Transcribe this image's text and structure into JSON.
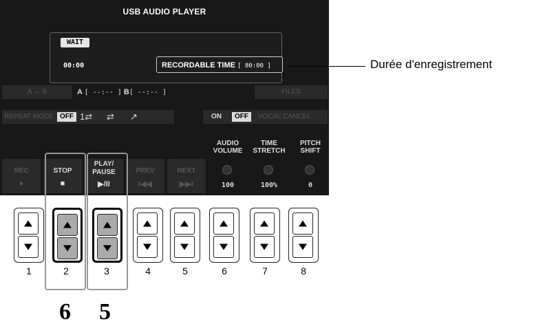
{
  "screen": {
    "title": "USB AUDIO PLAYER",
    "status": {
      "wait": "WAIT",
      "time": "00:00",
      "recordable_label": "RECORDABLE TIME",
      "recordable_value": "[ 80:00 ]"
    },
    "ab": {
      "button": "A ↔ B",
      "a_label": "A",
      "a_value": "[ --:-- ]",
      "b_label": "B",
      "b_value": "[ --:-- ]"
    },
    "files": "FILES",
    "repeat": {
      "label": "REPEAT MODE",
      "off": "OFF",
      "single_glyph": "1⇄",
      "all_glyph": "⇄",
      "random_glyph": "↗"
    },
    "vocal": {
      "on": "ON",
      "off": "OFF",
      "label": "VOCAL CANCEL"
    },
    "controls": [
      {
        "label": "REC",
        "symbol": "●"
      },
      {
        "label": "STOP",
        "symbol": "■"
      },
      {
        "label": "PLAY/\nPAUSE",
        "symbol": "▶/II"
      },
      {
        "label": "PREV",
        "symbol": "I◀◀"
      },
      {
        "label": "NEXT",
        "symbol": "▶▶I"
      }
    ],
    "params": [
      {
        "label": "AUDIO VOLUME",
        "value": "100"
      },
      {
        "label": "TIME STRETCH",
        "value": "100%"
      },
      {
        "label": "PITCH SHIFT",
        "value": "0"
      }
    ]
  },
  "buttons": [
    "1",
    "2",
    "3",
    "4",
    "5",
    "6",
    "7",
    "8"
  ],
  "callout": "Durée d'enregistrement",
  "steps": {
    "stop": "6",
    "play": "5"
  }
}
